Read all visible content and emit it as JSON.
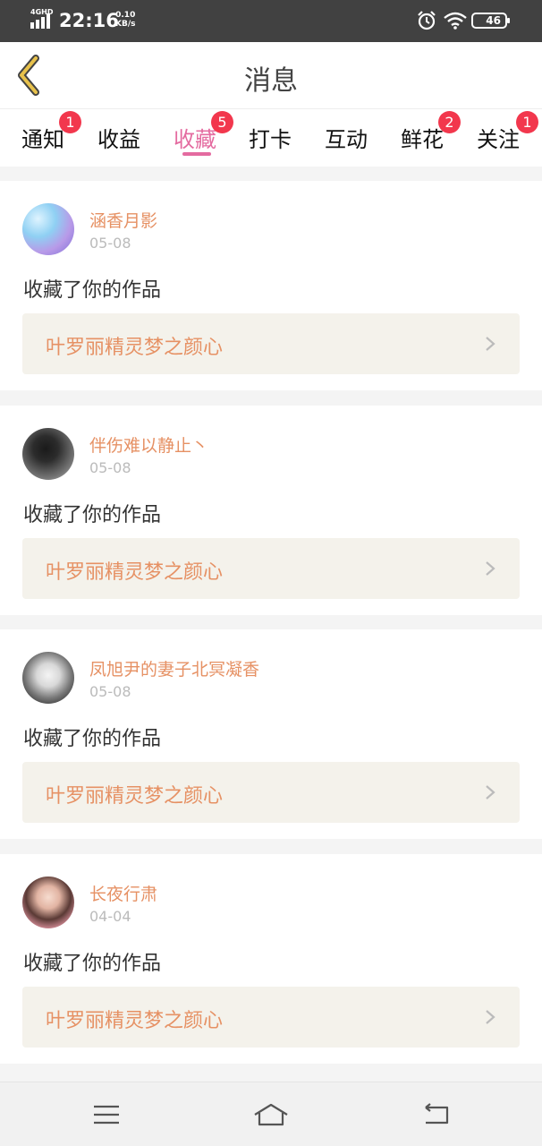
{
  "status_bar": {
    "network": "4GHD",
    "time": "22:16",
    "speed_value": "0.10",
    "speed_unit": "KB/s",
    "battery": "46",
    "icons": [
      "signal-icon",
      "alarm-icon",
      "wifi-icon",
      "battery-icon"
    ]
  },
  "header": {
    "title": "消息",
    "back_icon": "chevron-left-icon",
    "accent_color": "#e8c24c"
  },
  "tabs": [
    {
      "label": "通知",
      "badge": "1",
      "active": false
    },
    {
      "label": "收益",
      "badge": "",
      "active": false
    },
    {
      "label": "收藏",
      "badge": "5",
      "active": true
    },
    {
      "label": "打卡",
      "badge": "",
      "active": false
    },
    {
      "label": "互动",
      "badge": "",
      "active": false
    },
    {
      "label": "鲜花",
      "badge": "2",
      "active": false
    },
    {
      "label": "关注",
      "badge": "1",
      "active": false
    }
  ],
  "colors": {
    "active_tab": "#e46ba0",
    "badge": "#f2374d",
    "username": "#e69164",
    "work_link_bg": "#f4f2eb"
  },
  "messages": [
    {
      "username": "涵香月影",
      "date": "05-08",
      "action": "收藏了你的作品",
      "work_title": "叶罗丽精灵梦之颜心"
    },
    {
      "username": "伴伤难以静止丶",
      "date": "05-08",
      "action": "收藏了你的作品",
      "work_title": "叶罗丽精灵梦之颜心"
    },
    {
      "username": "凤旭尹的妻子北冥凝香",
      "date": "05-08",
      "action": "收藏了你的作品",
      "work_title": "叶罗丽精灵梦之颜心"
    },
    {
      "username": "长夜行肃",
      "date": "04-04",
      "action": "收藏了你的作品",
      "work_title": "叶罗丽精灵梦之颜心"
    }
  ],
  "nav_bar": {
    "icons": [
      "menu-icon",
      "home-icon",
      "back-icon"
    ]
  }
}
